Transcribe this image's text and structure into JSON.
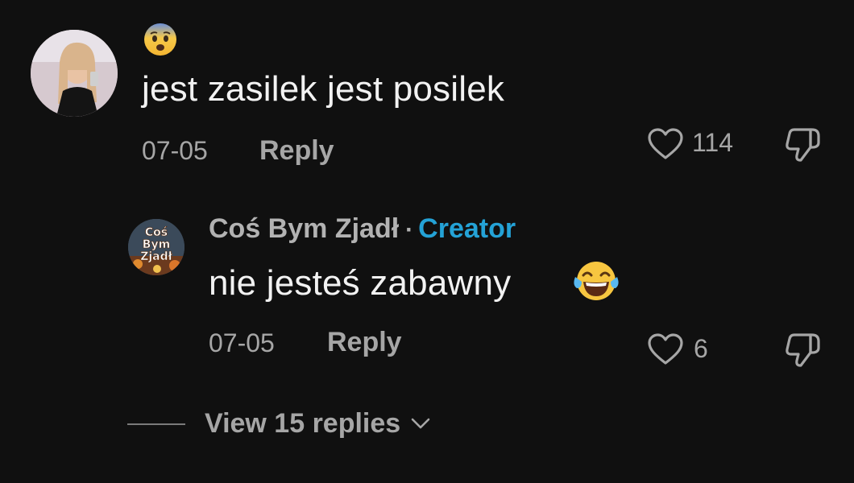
{
  "comment": {
    "emoji": "face-screaming-in-fear",
    "text": "jest zasilek jest posilek",
    "date": "07-05",
    "reply_label": "Reply",
    "like_count": "114",
    "icons": {
      "like": "heart-outline-icon",
      "dislike": "thumbs-down-icon"
    }
  },
  "reply": {
    "author": "Coś Bym Zjadł",
    "separator": "·",
    "badge": "Creator",
    "text": "nie jesteś zabawny",
    "emoji": "face-with-tears-of-joy",
    "date": "07-05",
    "reply_label": "Reply",
    "like_count": "6",
    "avatar_lines": [
      "Coś",
      "Bym",
      "Zjadł"
    ]
  },
  "view_replies": {
    "label": "View 15 replies"
  },
  "colors": {
    "background": "#101010",
    "text_primary": "#f2f2f2",
    "text_secondary": "#a6a6a6",
    "creator_badge": "#24a2d6"
  }
}
